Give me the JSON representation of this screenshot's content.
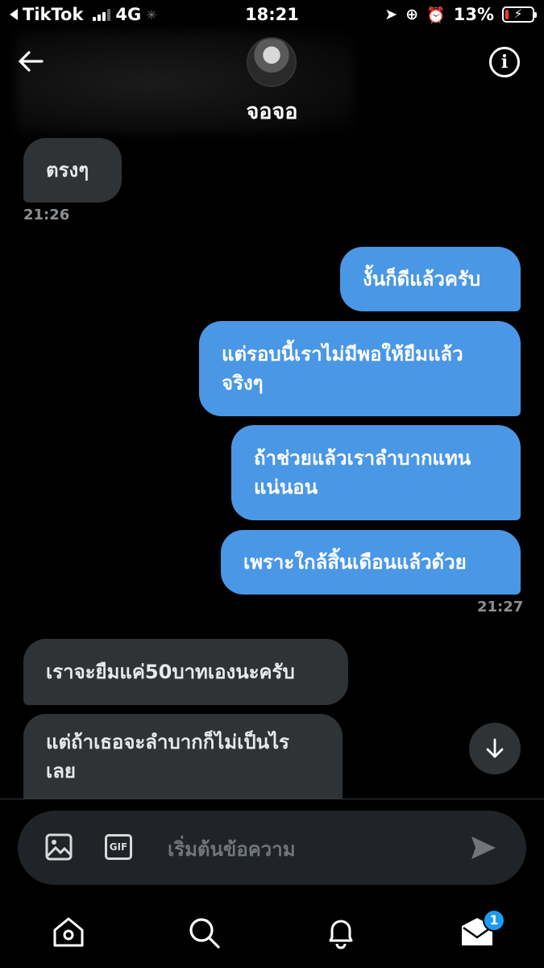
{
  "status_bar": {
    "back_app": "TikTok",
    "network": "4G",
    "time": "18:21",
    "battery_percent": "13%",
    "battery_level": 0.13,
    "battery_color": "#ff3b30"
  },
  "header": {
    "contact_name": "จอจอ",
    "back_icon": "arrow-left-icon",
    "info_icon": "info-icon"
  },
  "messages": [
    {
      "dir": "in",
      "lines": [
        "ตรงๆ"
      ]
    },
    {
      "time": "21:26"
    },
    {
      "dir": "out",
      "lines": [
        "งั้นก็ดีแล้วครับ"
      ]
    },
    {
      "dir": "out",
      "lines": [
        "แต่รอบนี้เราไม่มีพอให้ยืมแล้ว",
        "จริงๆ"
      ]
    },
    {
      "dir": "out",
      "lines": [
        "ถ้าช่วยแล้วเราลำบากแทน",
        "แน่นอน"
      ]
    },
    {
      "dir": "out",
      "lines": [
        "เพราะใกล้สิ้นเดือนแล้วด้วย"
      ]
    },
    {
      "time": "21:27"
    },
    {
      "dir": "in",
      "lines": [
        "เราจะยืมแค่50บาทเองนะครับ"
      ]
    },
    {
      "dir": "in",
      "lines": [
        "แต่ถ้าเธอจะลำบากก็ไม่เป็นไร",
        "เลย"
      ]
    }
  ],
  "composer": {
    "placeholder": "เริ่มต้นข้อความ",
    "gif_label": "GIF"
  },
  "tabbar": {
    "items": [
      "home-icon",
      "search-icon",
      "bell-icon",
      "mail-icon"
    ],
    "mail_badge": "1"
  },
  "colors": {
    "outgoing": "#4a97e6",
    "incoming": "#2f3336",
    "accent": "#1d9bf0"
  }
}
